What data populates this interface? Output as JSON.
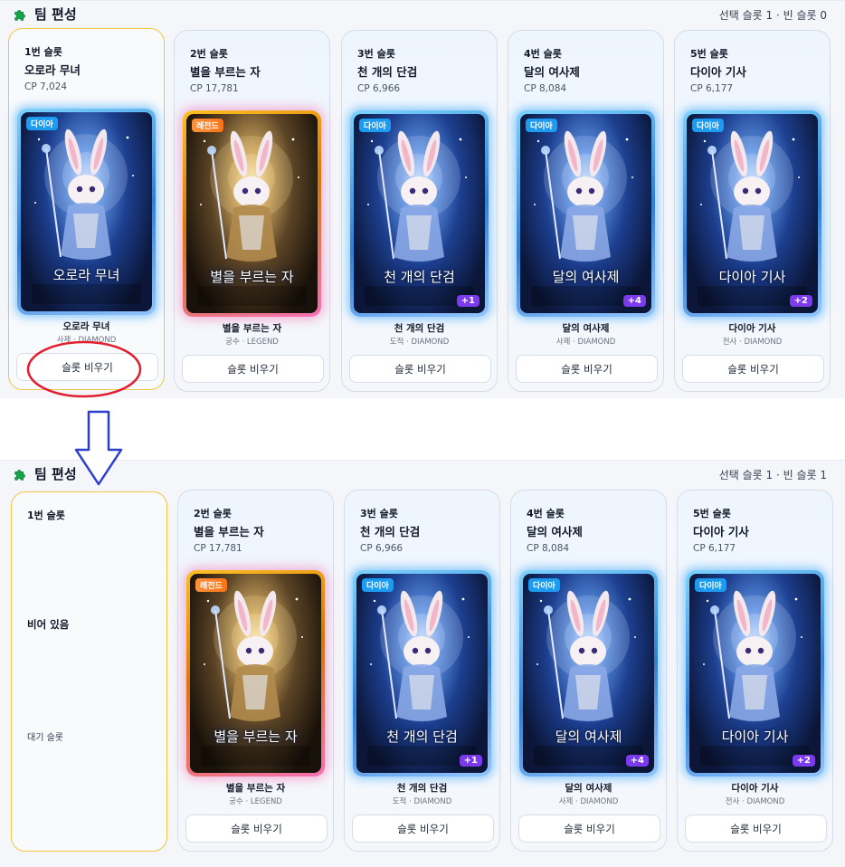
{
  "before": {
    "title": "팀 편성",
    "status": "선택 슬롯 1 · 빈 슬롯 0",
    "slots": [
      {
        "slot_label": "1번 슬롯",
        "name": "오로라 무녀",
        "cp": "CP 7,024",
        "rarity": "다이아",
        "card_title": "오로라 무녀",
        "card_sub": "",
        "plus": "",
        "char_name": "오로라 무녀",
        "char_class": "사제 · DIAMOND",
        "button": "슬롯 비우기"
      },
      {
        "slot_label": "2번 슬롯",
        "name": "별을 부르는 자",
        "cp": "CP 17,781",
        "rarity": "레전드",
        "card_title": "별을 부르는 자",
        "card_sub": "",
        "plus": "",
        "char_name": "별을 부르는 자",
        "char_class": "궁수 · LEGEND",
        "button": "슬롯 비우기"
      },
      {
        "slot_label": "3번 슬롯",
        "name": "천 개의 단검",
        "cp": "CP 6,966",
        "rarity": "다이아",
        "card_title": "천 개의 단검",
        "card_sub": "",
        "plus": "+1",
        "char_name": "천 개의 단검",
        "char_class": "도적 · DIAMOND",
        "button": "슬롯 비우기"
      },
      {
        "slot_label": "4번 슬롯",
        "name": "달의 여사제",
        "cp": "CP 8,084",
        "rarity": "다이아",
        "card_title": "달의 여사제",
        "card_sub": "",
        "plus": "+4",
        "char_name": "달의 여사제",
        "char_class": "사제 · DIAMOND",
        "button": "슬롯 비우기"
      },
      {
        "slot_label": "5번 슬롯",
        "name": "다이아 기사",
        "cp": "CP 6,177",
        "rarity": "다이아",
        "card_title": "다이아 기사",
        "card_sub": "",
        "plus": "+2",
        "char_name": "다이아 기사",
        "char_class": "전사 · DIAMOND",
        "button": "슬롯 비우기"
      }
    ]
  },
  "after": {
    "title": "팀 편성",
    "status": "선택 슬롯 1 · 빈 슬롯 1",
    "empty_slot": {
      "slot_label": "1번 슬롯",
      "empty_label": "비어 있음",
      "wait_label": "대기 슬롯"
    },
    "slots": [
      {
        "slot_label": "2번 슬롯",
        "name": "별을 부르는 자",
        "cp": "CP 17,781",
        "rarity": "레전드",
        "card_title": "별을 부르는 자",
        "card_sub": "",
        "plus": "",
        "char_name": "별을 부르는 자",
        "char_class": "궁수 · LEGEND",
        "button": "슬롯 비우기"
      },
      {
        "slot_label": "3번 슬롯",
        "name": "천 개의 단검",
        "cp": "CP 6,966",
        "rarity": "다이아",
        "card_title": "천 개의 단검",
        "card_sub": "",
        "plus": "+1",
        "char_name": "천 개의 단검",
        "char_class": "도적 · DIAMOND",
        "button": "슬롯 비우기"
      },
      {
        "slot_label": "4번 슬롯",
        "name": "달의 여사제",
        "cp": "CP 8,084",
        "rarity": "다이아",
        "card_title": "달의 여사제",
        "card_sub": "",
        "plus": "+4",
        "char_name": "달의 여사제",
        "char_class": "사제 · DIAMOND",
        "button": "슬롯 비우기"
      },
      {
        "slot_label": "5번 슬롯",
        "name": "다이아 기사",
        "cp": "CP 6,177",
        "rarity": "다이아",
        "card_title": "다이아 기사",
        "card_sub": "",
        "plus": "+2",
        "char_name": "다이아 기사",
        "char_class": "전사 · DIAMOND",
        "button": "슬롯 비우기"
      }
    ]
  },
  "icons": {
    "title": "puzzle-icon",
    "rabbit": "rabbit-icon",
    "arrow": "arrow-down-icon",
    "highlight": "ellipse-highlight"
  },
  "colors": {
    "selected_border": "#f4c542",
    "diamond": "#1d9bf0",
    "legend": "#f97316",
    "plus_badge": "#7c3aed",
    "annotation_red": "#e11d2e",
    "annotation_blue": "#2b3fd0"
  }
}
